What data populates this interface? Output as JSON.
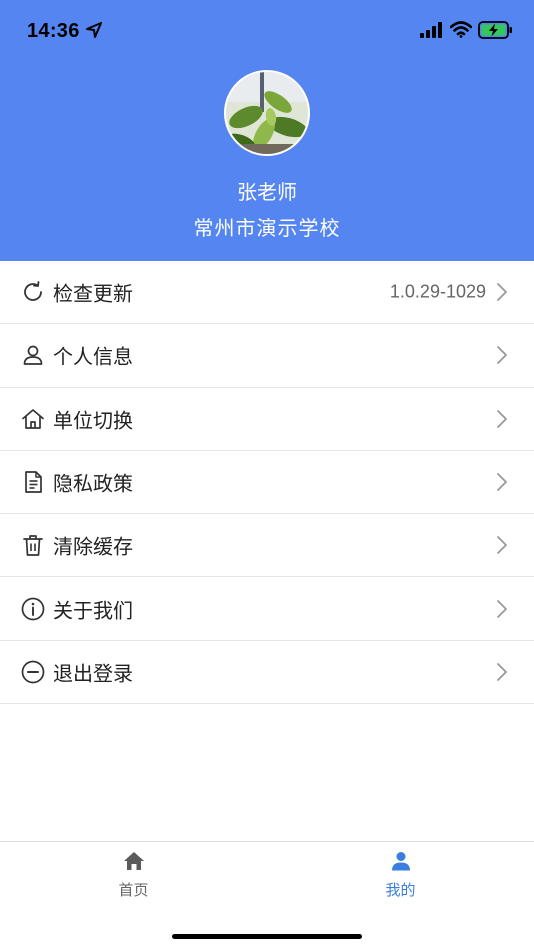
{
  "status_bar": {
    "time": "14:36",
    "icons": [
      "location-arrow-icon",
      "signal-icon",
      "wifi-icon",
      "battery-charging-icon"
    ]
  },
  "profile": {
    "name": "张老师",
    "school": "常州市演示学校",
    "avatar": "plant-leaves-photo"
  },
  "menu": [
    {
      "label": "检查更新",
      "value": "1.0.29-1029",
      "icon": "refresh-icon"
    },
    {
      "label": "个人信息",
      "icon": "user-icon"
    },
    {
      "label": "单位切换",
      "icon": "home-icon"
    },
    {
      "label": "隐私政策",
      "icon": "document-icon"
    },
    {
      "label": "清除缓存",
      "icon": "trash-icon"
    },
    {
      "label": "关于我们",
      "icon": "info-icon"
    },
    {
      "label": "退出登录",
      "icon": "minus-circle-icon"
    }
  ],
  "tabbar": {
    "home_label": "首页",
    "mine_label": "我的",
    "active": "我的"
  },
  "colors": {
    "header": "#5585f0",
    "active_tab": "#3a7ee0",
    "chevron": "#999999"
  }
}
